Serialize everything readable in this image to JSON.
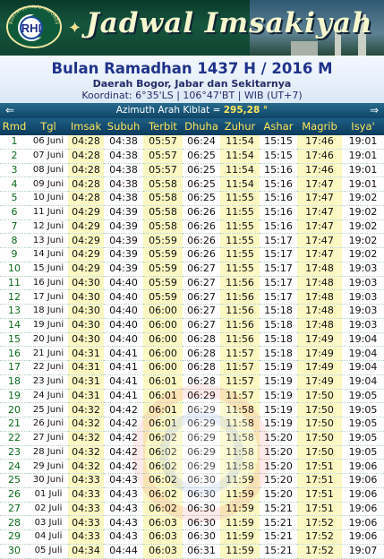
{
  "banner": {
    "logo_text": "RHI",
    "logo_subtext": "RUKYATUL HILAL INDONESIA",
    "title": "Jadwal Imsakiyah"
  },
  "header": {
    "title": "Bulan Ramadhan 1437 H / 2016 M",
    "region": "Daerah Bogor, Jabar dan Sekitarnya",
    "coordinates": "Koordinat: 6°35'LS | 106°47'BT | WIB (UT+7)"
  },
  "nav": {
    "azimuth_label": "Azimuth Arah Kiblat =",
    "azimuth_value": "295,28 °"
  },
  "columns": [
    "Rmd",
    "Tgl",
    "Imsak",
    "Subuh",
    "Terbit",
    "Dhuha",
    "Zuhur",
    "Ashar",
    "Magrib",
    "Isya'"
  ],
  "rows": [
    [
      "1",
      "06 Juni",
      "04:28",
      "04:38",
      "05:57",
      "06:24",
      "11:54",
      "15:15",
      "17:46",
      "19:01"
    ],
    [
      "2",
      "07 Juni",
      "04:28",
      "04:38",
      "05:57",
      "06:25",
      "11:54",
      "15:15",
      "17:46",
      "19:01"
    ],
    [
      "3",
      "08 Juni",
      "04:28",
      "04:38",
      "05:57",
      "06:25",
      "11:54",
      "15:16",
      "17:46",
      "19:01"
    ],
    [
      "4",
      "09 Juni",
      "04:28",
      "04:38",
      "05:58",
      "06:25",
      "11:54",
      "15:16",
      "17:47",
      "19:01"
    ],
    [
      "5",
      "10 Juni",
      "04:28",
      "04:38",
      "05:58",
      "06:25",
      "11:55",
      "15:16",
      "17:47",
      "19:02"
    ],
    [
      "6",
      "11 Juni",
      "04:29",
      "04:39",
      "05:58",
      "06:26",
      "11:55",
      "15:16",
      "17:47",
      "19:02"
    ],
    [
      "7",
      "12 Juni",
      "04:29",
      "04:39",
      "05:58",
      "06:26",
      "11:55",
      "15:16",
      "17:47",
      "19:02"
    ],
    [
      "8",
      "13 Juni",
      "04:29",
      "04:39",
      "05:59",
      "06:26",
      "11:55",
      "15:17",
      "17:47",
      "19:02"
    ],
    [
      "9",
      "14 Juni",
      "04:29",
      "04:39",
      "05:59",
      "06:26",
      "11:55",
      "15:17",
      "17:47",
      "19:02"
    ],
    [
      "10",
      "15 Juni",
      "04:29",
      "04:39",
      "05:59",
      "06:27",
      "11:55",
      "15:17",
      "17:48",
      "19:03"
    ],
    [
      "11",
      "16 Juni",
      "04:30",
      "04:40",
      "05:59",
      "06:27",
      "11:56",
      "15:17",
      "17:48",
      "19:03"
    ],
    [
      "12",
      "17 Juni",
      "04:30",
      "04:40",
      "05:59",
      "06:27",
      "11:56",
      "15:17",
      "17:48",
      "19:03"
    ],
    [
      "13",
      "18 Juni",
      "04:30",
      "04:40",
      "06:00",
      "06:27",
      "11:56",
      "15:18",
      "17:48",
      "19:03"
    ],
    [
      "14",
      "19 Juni",
      "04:30",
      "04:40",
      "06:00",
      "06:27",
      "11:56",
      "15:18",
      "17:48",
      "19:03"
    ],
    [
      "15",
      "20 Juni",
      "04:30",
      "04:40",
      "06:00",
      "06:28",
      "11:56",
      "15:18",
      "17:49",
      "19:04"
    ],
    [
      "16",
      "21 Juni",
      "04:31",
      "04:41",
      "06:00",
      "06:28",
      "11:57",
      "15:18",
      "17:49",
      "19:04"
    ],
    [
      "17",
      "22 Juni",
      "04:31",
      "04:41",
      "06:00",
      "06:28",
      "11:57",
      "15:19",
      "17:49",
      "19:04"
    ],
    [
      "18",
      "23 Juni",
      "04:31",
      "04:41",
      "06:01",
      "06:28",
      "11:57",
      "15:19",
      "17:49",
      "19:04"
    ],
    [
      "19",
      "24 Juni",
      "04:31",
      "04:41",
      "06:01",
      "06:29",
      "11:57",
      "15:19",
      "17:50",
      "19:05"
    ],
    [
      "20",
      "25 Juni",
      "04:32",
      "04:42",
      "06:01",
      "06:29",
      "11:58",
      "15:19",
      "17:50",
      "19:05"
    ],
    [
      "21",
      "26 Juni",
      "04:32",
      "04:42",
      "06:01",
      "06:29",
      "11:58",
      "15:19",
      "17:50",
      "19:05"
    ],
    [
      "22",
      "27 Juni",
      "04:32",
      "04:42",
      "06:02",
      "06:29",
      "11:58",
      "15:20",
      "17:50",
      "19:05"
    ],
    [
      "23",
      "28 Juni",
      "04:32",
      "04:42",
      "06:02",
      "06:29",
      "11:58",
      "15:20",
      "17:50",
      "19:05"
    ],
    [
      "24",
      "29 Juni",
      "04:32",
      "04:42",
      "06:02",
      "06:29",
      "11:58",
      "15:20",
      "17:51",
      "19:06"
    ],
    [
      "25",
      "30 Juni",
      "04:33",
      "04:43",
      "06:02",
      "06:30",
      "11:59",
      "15:20",
      "17:51",
      "19:06"
    ],
    [
      "26",
      "01 Juli",
      "04:33",
      "04:43",
      "06:02",
      "06:30",
      "11:59",
      "15:20",
      "17:51",
      "19:06"
    ],
    [
      "27",
      "02 Juli",
      "04:33",
      "04:43",
      "06:02",
      "06:30",
      "11:59",
      "15:21",
      "17:51",
      "19:06"
    ],
    [
      "28",
      "03 Juli",
      "04:33",
      "04:43",
      "06:03",
      "06:30",
      "11:59",
      "15:21",
      "17:52",
      "19:06"
    ],
    [
      "29",
      "04 Juli",
      "04:33",
      "04:43",
      "06:03",
      "06:30",
      "11:59",
      "15:21",
      "17:52",
      "19:06"
    ],
    [
      "30",
      "05 Juli",
      "04:34",
      "04:44",
      "06:03",
      "06:31",
      "11:59",
      "15:21",
      "17:52",
      "19:07"
    ]
  ],
  "colors": {
    "rmd_text": "#0b6b1c",
    "alt_column_bg": "#fbf8c3",
    "header_text": "#ffe65a",
    "title_text": "#20338a"
  },
  "icons": {
    "prev": "arrow-left-icon",
    "next": "arrow-right-icon"
  }
}
